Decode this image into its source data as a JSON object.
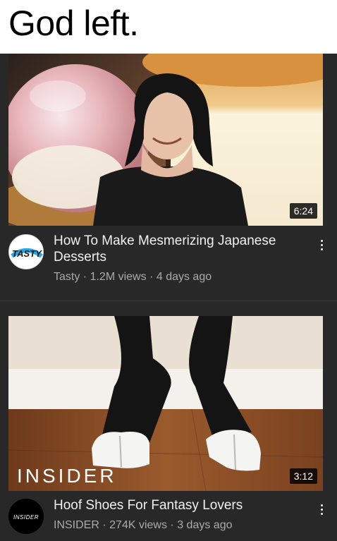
{
  "caption": {
    "text": "God left."
  },
  "videos": [
    {
      "duration": "6:24",
      "title": "How To Make Mesmerizing Japanese Desserts",
      "channel": "Tasty",
      "views": "1.2M views",
      "age": "4 days ago",
      "avatar_text": "TASTY",
      "separator": "·"
    },
    {
      "duration": "3:12",
      "title": "Hoof Shoes For Fantasy Lovers",
      "channel": "INSIDER",
      "views": "274K views",
      "age": "3 days ago",
      "avatar_text": "INSIDER",
      "watermark": "INSIDER",
      "separator": "·"
    }
  ],
  "colors": {
    "background": "#282828",
    "title_text": "#f1f1f1",
    "secondary_text": "#aaaaaa",
    "duration_badge": "#000000"
  },
  "icons": [
    "more-vertical-icon"
  ]
}
